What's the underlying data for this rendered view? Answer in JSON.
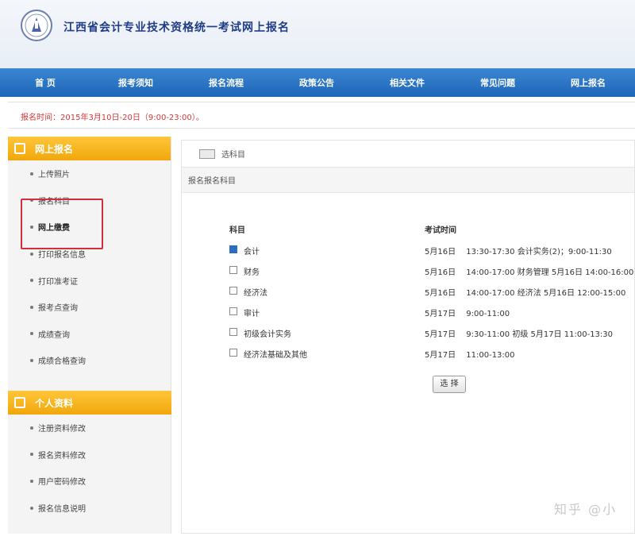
{
  "header": {
    "site_title": "江西省会计专业技术资格统一考试网上报名"
  },
  "nav": {
    "items": [
      "首 页",
      "报考须知",
      "报名流程",
      "政策公告",
      "相关文件",
      "常见问题",
      "网上报名"
    ]
  },
  "notice": {
    "text": "报名时间：2015年3月10日-20日（9:00-23:00）。"
  },
  "sidebar": {
    "group1": {
      "title": "网上报名",
      "items": [
        "上传照片",
        "报名科目",
        "网上缴费",
        "打印报名信息",
        "打印准考证",
        "报考点查询",
        "成绩查询",
        "成绩合格查询"
      ]
    },
    "group2": {
      "title": "个人资料",
      "items": [
        "注册资料修改",
        "报名资料修改",
        "用户密码修改",
        "报名信息说明"
      ]
    }
  },
  "main": {
    "breadcrumb": "选科目",
    "subtitle": "报名报名科目",
    "col_subject": "科目",
    "col_time": "考试时间",
    "rows": [
      {
        "subject": "会计",
        "time": "5月16日 　13:30-17:30 会计实务(2)；9:00-11:30 ",
        "checked": true
      },
      {
        "subject": "财务",
        "time": "5月16日 　14:00-17:00 财务管理  5月16日 14:00-16:00",
        "checked": false
      },
      {
        "subject": "经济法",
        "time": "5月16日 　14:00-17:00 经济法   5月16日 12:00-15:00",
        "checked": false
      },
      {
        "subject": "审计",
        "time": "5月17日 　9:00-11:00",
        "checked": false
      },
      {
        "subject": "初级会计实务",
        "time": "5月17日 　9:30-11:00 初级  5月17日 11:00-13:30",
        "checked": false
      },
      {
        "subject": "经济法基础及其他",
        "time": "5月17日 　11:00-13:00",
        "checked": false
      }
    ],
    "button_label": "选 择"
  },
  "watermark": "知乎 @小"
}
